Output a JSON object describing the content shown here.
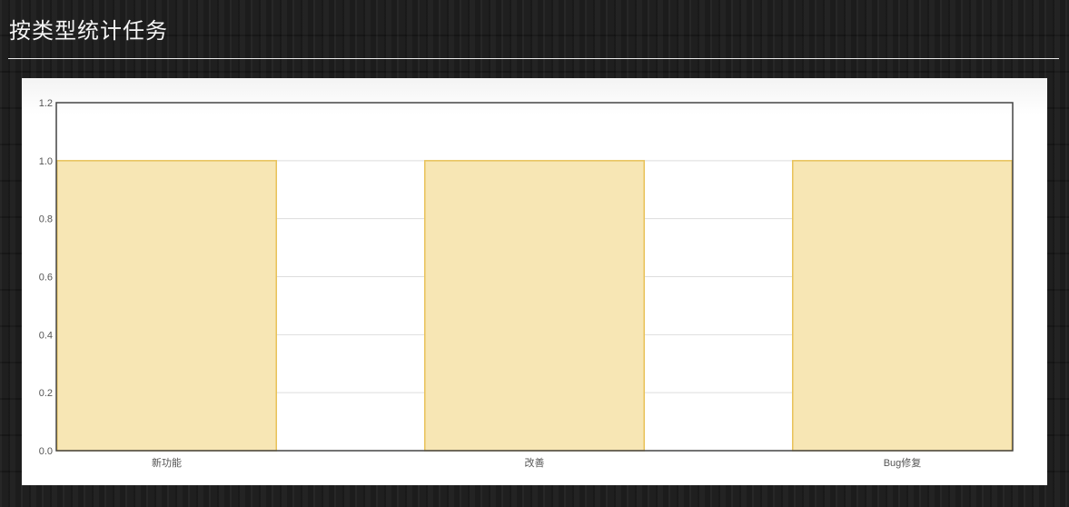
{
  "page": {
    "title": "按类型统计任务"
  },
  "chart_data": {
    "type": "bar",
    "title": "",
    "xlabel": "",
    "ylabel": "",
    "categories": [
      "新功能",
      "改善",
      "Bug修复"
    ],
    "values": [
      1.0,
      1.0,
      1.0
    ],
    "ylim": [
      0,
      1.2
    ],
    "yticks": [
      "0.0",
      "0.2",
      "0.4",
      "0.6",
      "0.8",
      "1.0",
      "1.2"
    ],
    "grid": true,
    "legend": "none",
    "colors": {
      "bar_fill": "#f7e6b4",
      "bar_stroke": "#e8c25a",
      "grid": "#dddddd",
      "axis": "#444444"
    }
  }
}
